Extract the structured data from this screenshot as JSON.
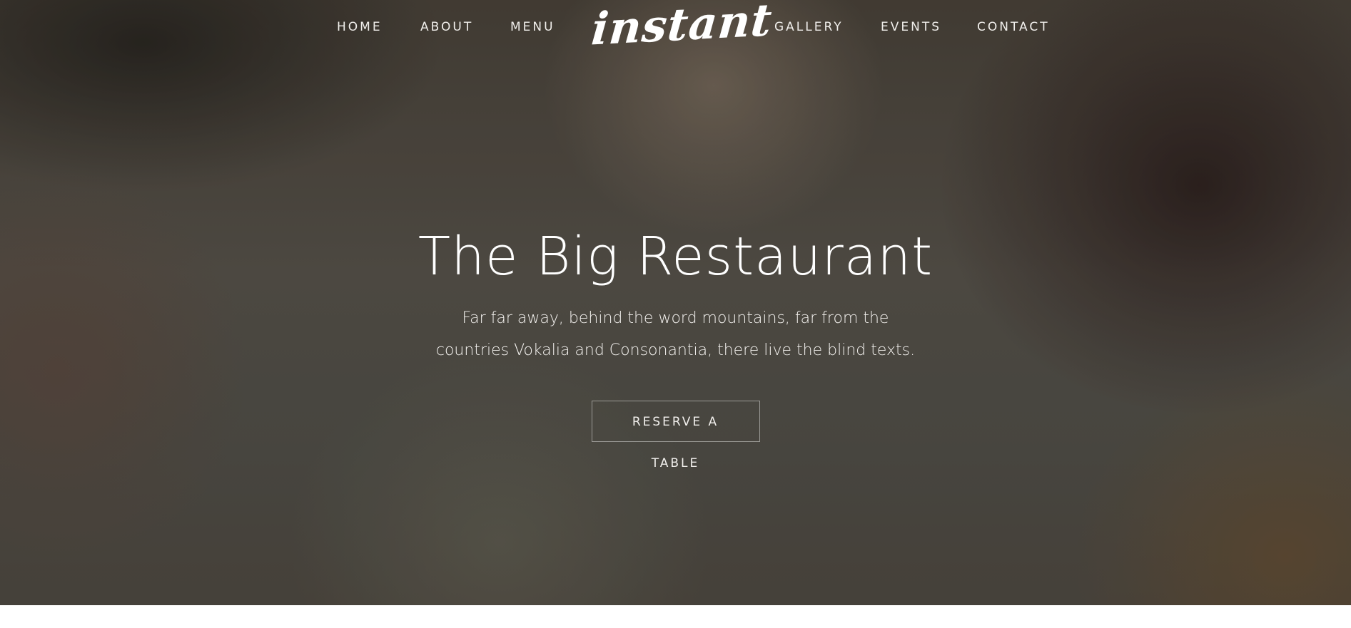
{
  "nav": {
    "left_items": [
      {
        "label": "HOME"
      },
      {
        "label": "ABOUT"
      },
      {
        "label": "MENU"
      }
    ],
    "logo_text": "instant",
    "right_items": [
      {
        "label": "GALLERY"
      },
      {
        "label": "EVENTS"
      },
      {
        "label": "CONTACT"
      }
    ]
  },
  "hero": {
    "title": "The Big Restaurant",
    "subtitle_line1": "Far far away, behind the word mountains, far from the",
    "subtitle_line2": "countries Vokalia and Consonantia, there live the blind texts.",
    "cta_label": "RESERVE A TABLE"
  }
}
